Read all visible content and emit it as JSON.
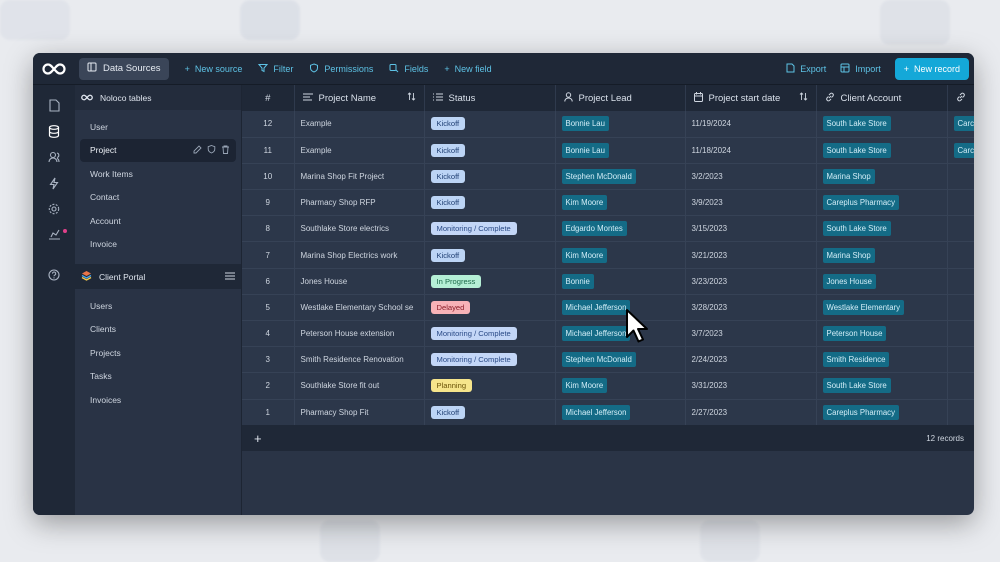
{
  "topbar": {
    "data_sources_label": "Data Sources",
    "new_source_label": "New source",
    "filter_label": "Filter",
    "permissions_label": "Permissions",
    "fields_label": "Fields",
    "new_field_label": "New field",
    "export_label": "Export",
    "import_label": "Import",
    "new_record_label": "New record"
  },
  "sidebar": {
    "noloco_header": "Noloco tables",
    "noloco_items": [
      "User",
      "Project",
      "Work Items",
      "Contact",
      "Account",
      "Invoice"
    ],
    "active_item": "Project",
    "portal_header": "Client Portal",
    "portal_items": [
      "Users",
      "Clients",
      "Projects",
      "Tasks",
      "Invoices"
    ]
  },
  "table": {
    "columns": [
      "#",
      "Project Name",
      "Status",
      "Project Lead",
      "Project start date",
      "Client Account"
    ],
    "rows": [
      {
        "num": "12",
        "name": "Example",
        "status": "Kickoff",
        "lead": "Bonnie Lau",
        "date": "11/19/2024",
        "account": "South Lake Store",
        "extra": "Carc"
      },
      {
        "num": "11",
        "name": "Example",
        "status": "Kickoff",
        "lead": "Bonnie Lau",
        "date": "11/18/2024",
        "account": "South Lake Store",
        "extra": "Carc"
      },
      {
        "num": "10",
        "name": "Marina Shop Fit Project",
        "status": "Kickoff",
        "lead": "Stephen McDonald",
        "date": "3/2/2023",
        "account": "Marina Shop",
        "extra": ""
      },
      {
        "num": "9",
        "name": "Pharmacy Shop RFP",
        "status": "Kickoff",
        "lead": "Kim Moore",
        "date": "3/9/2023",
        "account": "Careplus Pharmacy",
        "extra": ""
      },
      {
        "num": "8",
        "name": "Southlake Store electrics",
        "status": "Monitoring / Complete",
        "lead": "Edgardo Montes",
        "date": "3/15/2023",
        "account": "South Lake Store",
        "extra": ""
      },
      {
        "num": "7",
        "name": "Marina Shop Electrics work",
        "status": "Kickoff",
        "lead": "Kim Moore",
        "date": "3/21/2023",
        "account": "Marina Shop",
        "extra": ""
      },
      {
        "num": "6",
        "name": "Jones House",
        "status": "In Progress",
        "lead": "Bonnie",
        "date": "3/23/2023",
        "account": "Jones House",
        "extra": ""
      },
      {
        "num": "5",
        "name": "Westlake Elementary School se",
        "status": "Delayed",
        "lead": "Michael Jefferson",
        "date": "3/28/2023",
        "account": "Westlake Elementary",
        "extra": ""
      },
      {
        "num": "4",
        "name": "Peterson House extension",
        "status": "Monitoring / Complete",
        "lead": "Michael Jefferson",
        "date": "3/7/2023",
        "account": "Peterson House",
        "extra": ""
      },
      {
        "num": "3",
        "name": "Smith Residence Renovation",
        "status": "Monitoring / Complete",
        "lead": "Stephen McDonald",
        "date": "2/24/2023",
        "account": "Smith Residence",
        "extra": ""
      },
      {
        "num": "2",
        "name": "Southlake Store fit out",
        "status": "Planning",
        "lead": "Kim Moore",
        "date": "3/31/2023",
        "account": "South Lake Store",
        "extra": ""
      },
      {
        "num": "1",
        "name": "Pharmacy Shop Fit",
        "status": "Kickoff",
        "lead": "Michael Jefferson",
        "date": "2/27/2023",
        "account": "Careplus Pharmacy",
        "extra": ""
      }
    ],
    "record_count": "12 records"
  },
  "status_colors": {
    "Kickoff": {
      "bg": "#bcd4f5",
      "fg": "#1f3e72"
    },
    "Monitoring / Complete": {
      "bg": "#c3d6f7",
      "fg": "#2a4a86"
    },
    "In Progress": {
      "bg": "#b5efd6",
      "fg": "#1c6a4a"
    },
    "Delayed": {
      "bg": "#f7b2b7",
      "fg": "#8b1d28"
    },
    "Planning": {
      "bg": "#f6e58b",
      "fg": "#6b5407"
    }
  },
  "colors": {
    "accent": "#14a8d8",
    "link": "#5ec3e6"
  }
}
